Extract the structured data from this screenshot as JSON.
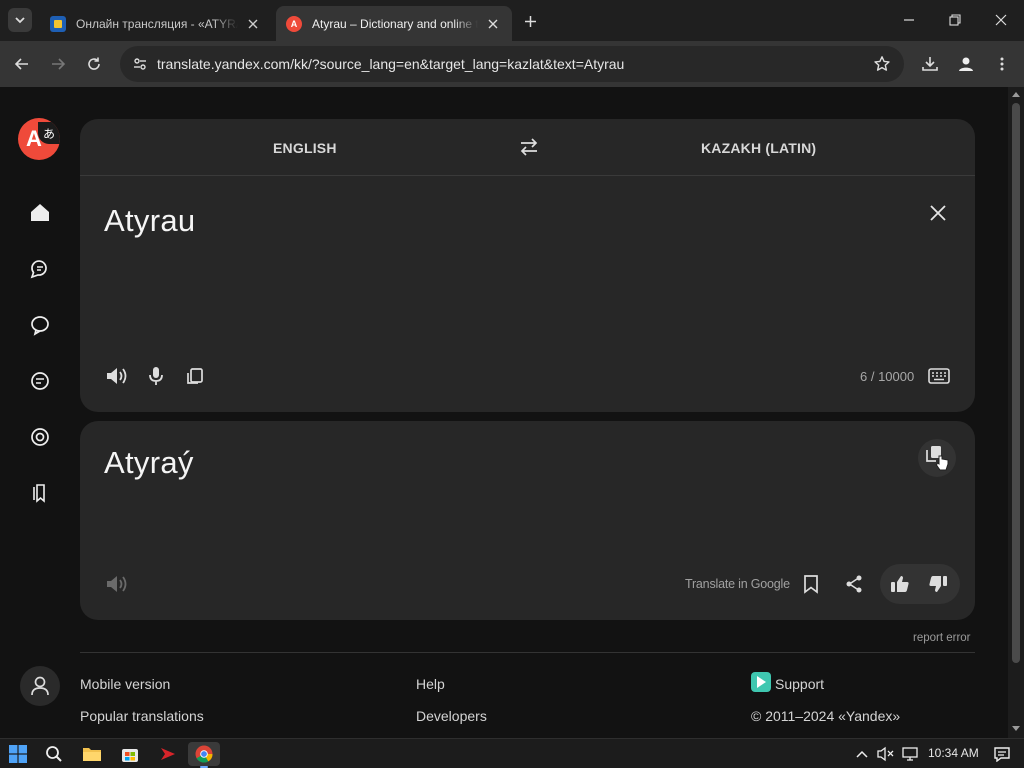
{
  "browser": {
    "tabs": [
      {
        "title": "Онлайн трансляция - «ATYRAU»",
        "active": false
      },
      {
        "title": "Atyrau – Dictionary and online translation",
        "active": true
      }
    ],
    "url": "translate.yandex.com/kk/?source_lang=en&target_lang=kazlat&text=Atyrau"
  },
  "translator": {
    "source_lang": "ENGLISH",
    "target_lang": "KAZAKH (LATIN)",
    "source_text": "Atyrau",
    "char_count": "6 / 10000",
    "translation": "Atyraý",
    "translate_in_google": "Translate in Google",
    "report_error": "report error"
  },
  "footer": {
    "mobile_version": "Mobile version",
    "popular_translations": "Popular translations",
    "help": "Help",
    "developers": "Developers",
    "support": "Support",
    "copyright": "© 2011–2024 «Yandex»"
  },
  "taskbar": {
    "time": "10:34 AM"
  },
  "colors": {
    "brand_red": "#ef4a3a",
    "background": "#121212",
    "card": "#272727"
  }
}
